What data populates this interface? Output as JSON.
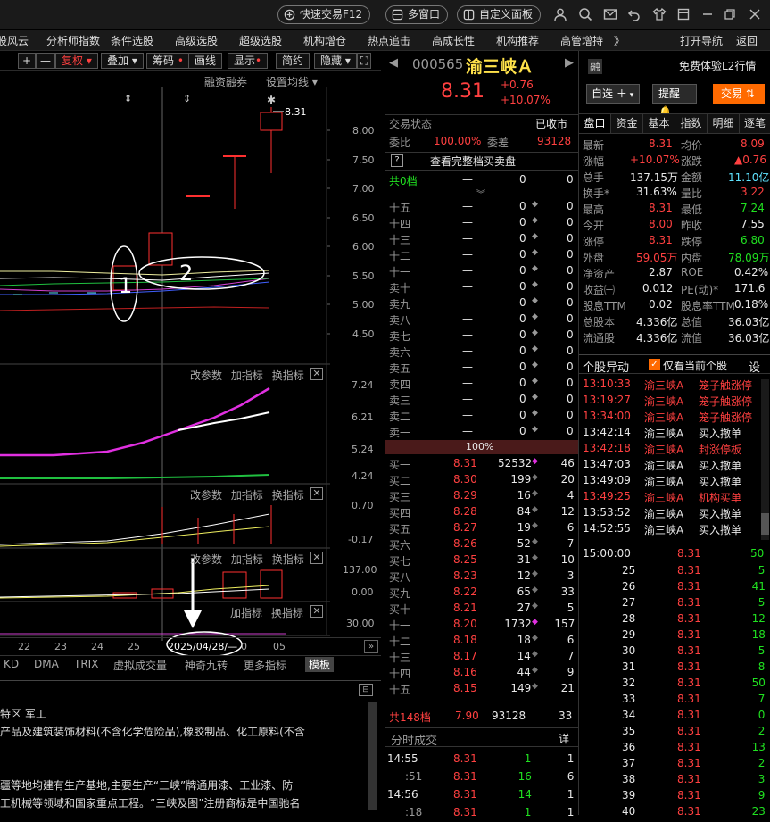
{
  "topbar": {
    "quick_trade": "快速交易F12",
    "multi_window": "多窗口",
    "custom_panel": "自定义面板"
  },
  "menu": [
    "股风云",
    "分析师指数",
    "条件选股",
    "高级选股",
    "超级选股",
    "机构增仓",
    "热点追击",
    "高成长性",
    "机构推荐",
    "高管增持",
    "》"
  ],
  "menu_right": {
    "start_nav": "打开导航",
    "back": "返回"
  },
  "chart_toolbar": {
    "plus": "+",
    "minus": "—",
    "fuquan": "复权",
    "overlay": "叠加",
    "chips": "筹码",
    "draw": "画线",
    "display": "显示",
    "simple": "简约",
    "hide": "隐藏"
  },
  "chart_header": {
    "margin": "融资融券",
    "ma_setting": "设置均线"
  },
  "price_axis": [
    "8.00",
    "7.50",
    "7.00",
    "6.50",
    "6.00",
    "5.50",
    "5.00",
    "4.50"
  ],
  "price_label": "8.31",
  "annotations": {
    "circle1": "1",
    "circle2": "2"
  },
  "panel_labels": {
    "params": "改参数",
    "add_index": "加指标",
    "switch_index": "换指标"
  },
  "ind1_axis": [
    "7.24",
    "6.21",
    "5.24",
    "4.24"
  ],
  "ind2_axis": [
    "0.70",
    "-0.17"
  ],
  "ind3_axis": [
    "137.00",
    "0.00"
  ],
  "ind4_axis": [
    "30.00"
  ],
  "date_axis": [
    "22",
    "23",
    "24",
    "25",
    "0",
    "05"
  ],
  "date_cursor": "2025/04/28/—",
  "bottom_tabs": [
    "KD",
    "DMA",
    "TRIX",
    "虚拟成交量",
    "神奇九转",
    "更多指标",
    "模板"
  ],
  "info": {
    "line1": "特区  军工",
    "line2": "产品及建筑装饰材料(不含化学危险品),橡胶制品、化工原料(不含",
    "line3": "疆等地均建有生产基地,主要生产“三峡”牌通用漆、工业漆、防",
    "line4": "工机械等领域和国家重点工程。“三峡及图”注册商标是中国驰名"
  },
  "stock": {
    "code": "000565",
    "name": "渝三峡Ａ",
    "price": "8.31",
    "change": "+0.76",
    "change_pct": "+10.07%",
    "margin_tag": "融",
    "l2": "免费体验L2行情",
    "self_select": "自选",
    "alert": "提醒",
    "trade": "交易"
  },
  "status": {
    "label": "交易状态",
    "value": "已收市"
  },
  "weibi": {
    "label": "委比",
    "value": "100.00%",
    "diff_label": "委差",
    "diff": "93128"
  },
  "full_book": "查看完整档买卖盘",
  "sell_header": {
    "label": "共0档",
    "dash": "—",
    "vol": "0",
    "cnt": "0"
  },
  "sell_levels": [
    {
      "label": "十五",
      "price": "—",
      "vol": "0",
      "cnt": "0"
    },
    {
      "label": "十四",
      "price": "—",
      "vol": "0",
      "cnt": "0"
    },
    {
      "label": "十三",
      "price": "—",
      "vol": "0",
      "cnt": "0"
    },
    {
      "label": "十二",
      "price": "—",
      "vol": "0",
      "cnt": "0"
    },
    {
      "label": "十一",
      "price": "—",
      "vol": "0",
      "cnt": "0"
    },
    {
      "label": "卖十",
      "price": "—",
      "vol": "0",
      "cnt": "0"
    },
    {
      "label": "卖九",
      "price": "—",
      "vol": "0",
      "cnt": "0"
    },
    {
      "label": "卖八",
      "price": "—",
      "vol": "0",
      "cnt": "0"
    },
    {
      "label": "卖七",
      "price": "—",
      "vol": "0",
      "cnt": "0"
    },
    {
      "label": "卖六",
      "price": "—",
      "vol": "0",
      "cnt": "0"
    },
    {
      "label": "卖五",
      "price": "—",
      "vol": "0",
      "cnt": "0"
    },
    {
      "label": "卖四",
      "price": "—",
      "vol": "0",
      "cnt": "0"
    },
    {
      "label": "卖三",
      "price": "—",
      "vol": "0",
      "cnt": "0"
    },
    {
      "label": "卖二",
      "price": "—",
      "vol": "0",
      "cnt": "0"
    },
    {
      "label": "卖一",
      "price": "—",
      "vol": "0",
      "cnt": "0"
    }
  ],
  "ratio_bar": "100%",
  "buy_levels": [
    {
      "label": "买一",
      "price": "8.31",
      "vol": "52532",
      "cnt": "46"
    },
    {
      "label": "买二",
      "price": "8.30",
      "vol": "199",
      "cnt": "20"
    },
    {
      "label": "买三",
      "price": "8.29",
      "vol": "16",
      "cnt": "4"
    },
    {
      "label": "买四",
      "price": "8.28",
      "vol": "84",
      "cnt": "12"
    },
    {
      "label": "买五",
      "price": "8.27",
      "vol": "19",
      "cnt": "6"
    },
    {
      "label": "买六",
      "price": "8.26",
      "vol": "52",
      "cnt": "7"
    },
    {
      "label": "买七",
      "price": "8.25",
      "vol": "31",
      "cnt": "10"
    },
    {
      "label": "买八",
      "price": "8.23",
      "vol": "12",
      "cnt": "3"
    },
    {
      "label": "买九",
      "price": "8.22",
      "vol": "65",
      "cnt": "33"
    },
    {
      "label": "买十",
      "price": "8.21",
      "vol": "27",
      "cnt": "5"
    },
    {
      "label": "十一",
      "price": "8.20",
      "vol": "1732",
      "cnt": "157"
    },
    {
      "label": "十二",
      "price": "8.18",
      "vol": "18",
      "cnt": "6"
    },
    {
      "label": "十三",
      "price": "8.17",
      "vol": "14",
      "cnt": "7"
    },
    {
      "label": "十四",
      "price": "8.16",
      "vol": "44",
      "cnt": "9"
    },
    {
      "label": "十五",
      "price": "8.15",
      "vol": "149",
      "cnt": "21"
    }
  ],
  "buy_total": {
    "label": "共148档",
    "price": "7.90",
    "vol": "93128",
    "cnt": "33"
  },
  "ticks_header": {
    "label": "分时成交",
    "detail": "详"
  },
  "ticks": [
    {
      "time": "14:55",
      "price": "8.31",
      "vol": "1",
      "cnt": "1"
    },
    {
      "time": ":51",
      "price": "8.31",
      "vol": "16",
      "cnt": "6"
    },
    {
      "time": "14:56",
      "price": "8.31",
      "vol": "14",
      "cnt": "1"
    },
    {
      "time": ":18",
      "price": "8.31",
      "vol": "1",
      "cnt": "1"
    }
  ],
  "right_tabs": [
    "盘口",
    "资金",
    "基本",
    "指数",
    "明细",
    "逐笔"
  ],
  "stats": [
    {
      "l": "最新",
      "v": "8.31",
      "vc": "red",
      "l2": "均价",
      "v2": "8.09",
      "vc2": "red"
    },
    {
      "l": "涨幅",
      "v": "+10.07%",
      "vc": "red",
      "l2": "涨跌",
      "v2": "▲0.76",
      "vc2": "red"
    },
    {
      "l": "总手",
      "v": "137.15万",
      "vc": "white",
      "l2": "金额",
      "v2": "11.10亿",
      "vc2": "cyan"
    },
    {
      "l": "换手*",
      "v": "31.63%",
      "vc": "white",
      "l2": "量比",
      "v2": "3.22",
      "vc2": "red"
    },
    {
      "l": "最高",
      "v": "8.31",
      "vc": "red",
      "l2": "最低",
      "v2": "7.24",
      "vc2": "green"
    },
    {
      "l": "今开",
      "v": "8.00",
      "vc": "red",
      "l2": "昨收",
      "v2": "7.55",
      "vc2": "white"
    },
    {
      "l": "涨停",
      "v": "8.31",
      "vc": "red",
      "l2": "跌停",
      "v2": "6.80",
      "vc2": "green"
    },
    {
      "l": "外盘",
      "v": "59.05万",
      "vc": "red",
      "l2": "内盘",
      "v2": "78.09万",
      "vc2": "green"
    },
    {
      "l": "净资产",
      "v": "2.87",
      "vc": "white",
      "l2": "ROE",
      "v2": "0.42%",
      "vc2": "white"
    },
    {
      "l": "收益㈠",
      "v": "0.012",
      "vc": "white",
      "l2": "PE(动)*",
      "v2": "171.6",
      "vc2": "white"
    },
    {
      "l": "股息TTM",
      "v": "0.02",
      "vc": "white",
      "l2": "股息率TTM",
      "v2": "0.18%",
      "vc2": "white"
    },
    {
      "l": "总股本",
      "v": "4.336亿",
      "vc": "white",
      "l2": "总值",
      "v2": "36.03亿",
      "vc2": "white"
    },
    {
      "l": "流通股",
      "v": "4.336亿",
      "vc": "white",
      "l2": "流值",
      "v2": "36.03亿",
      "vc2": "white"
    }
  ],
  "anomaly": {
    "title": "个股异动",
    "checkbox": "仅看当前个股",
    "settings": "设"
  },
  "anomalies": [
    {
      "time": "13:10:33",
      "name": "渝三峡A",
      "event": "笼子触涨停",
      "c": "red"
    },
    {
      "time": "13:19:27",
      "name": "渝三峡A",
      "event": "笼子触涨停",
      "c": "red"
    },
    {
      "time": "13:34:00",
      "name": "渝三峡A",
      "event": "笼子触涨停",
      "c": "red"
    },
    {
      "time": "13:42:14",
      "name": "渝三峡A",
      "event": "买入撤单",
      "c": "white"
    },
    {
      "time": "13:42:18",
      "name": "渝三峡A",
      "event": "封涨停板",
      "c": "red"
    },
    {
      "time": "13:47:03",
      "name": "渝三峡A",
      "event": "买入撤单",
      "c": "white"
    },
    {
      "time": "13:49:09",
      "name": "渝三峡A",
      "event": "买入撤单",
      "c": "white"
    },
    {
      "time": "13:49:25",
      "name": "渝三峡A",
      "event": "机构买单",
      "c": "red"
    },
    {
      "time": "13:53:52",
      "name": "渝三峡A",
      "event": "买入撤单",
      "c": "white"
    },
    {
      "time": "14:52:55",
      "name": "渝三峡A",
      "event": "买入撤单",
      "c": "white"
    }
  ],
  "trades_header": {
    "time": "15:00:00",
    "price": "8.31",
    "vol": "50"
  },
  "trades": [
    {
      "t": "25",
      "p": "8.31",
      "v": "5"
    },
    {
      "t": "26",
      "p": "8.31",
      "v": "41"
    },
    {
      "t": "27",
      "p": "8.31",
      "v": "5"
    },
    {
      "t": "28",
      "p": "8.31",
      "v": "12"
    },
    {
      "t": "29",
      "p": "8.31",
      "v": "18"
    },
    {
      "t": "30",
      "p": "8.31",
      "v": "5"
    },
    {
      "t": "31",
      "p": "8.31",
      "v": "8"
    },
    {
      "t": "32",
      "p": "8.31",
      "v": "50"
    },
    {
      "t": "33",
      "p": "8.31",
      "v": "7"
    },
    {
      "t": "34",
      "p": "8.31",
      "v": "0"
    },
    {
      "t": "35",
      "p": "8.31",
      "v": "2"
    },
    {
      "t": "36",
      "p": "8.31",
      "v": "13"
    },
    {
      "t": "37",
      "p": "8.31",
      "v": "2"
    },
    {
      "t": "38",
      "p": "8.31",
      "v": "3"
    },
    {
      "t": "39",
      "p": "8.31",
      "v": "9"
    },
    {
      "t": "40",
      "p": "8.31",
      "v": "23"
    }
  ],
  "colors": {
    "up": "#ff4040",
    "down": "#20e020",
    "accent": "#ff6a00",
    "bg": "#000000"
  }
}
